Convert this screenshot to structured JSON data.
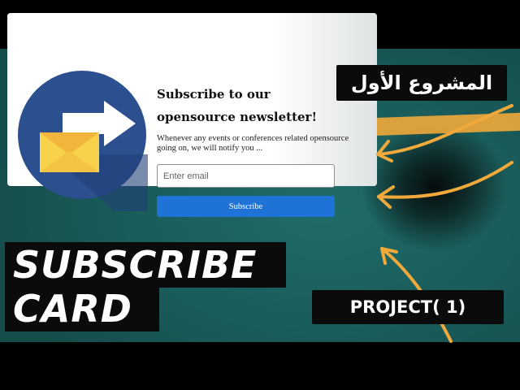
{
  "card": {
    "title_line1": "Subscribe to our",
    "title_line2": "opensource newsletter!",
    "description": "Whenever any events or conferences related opensource going on, we will notify you ...",
    "email_placeholder": "Enter email",
    "subscribe_label": "Subscribe"
  },
  "overlay": {
    "arabic_label": "المشروع الأول",
    "big_title_line1": "SUBSCRIBE",
    "big_title_line2": "CARD",
    "project_label": "PROJECT( 1)"
  },
  "colors": {
    "background_teal": "#1a5d5b",
    "button_blue": "#1f73d6",
    "accent_orange": "#f0a93a",
    "illustration_circle": "#2b4f8f"
  },
  "icons": [
    "envelope-icon",
    "arrow-right-icon"
  ]
}
